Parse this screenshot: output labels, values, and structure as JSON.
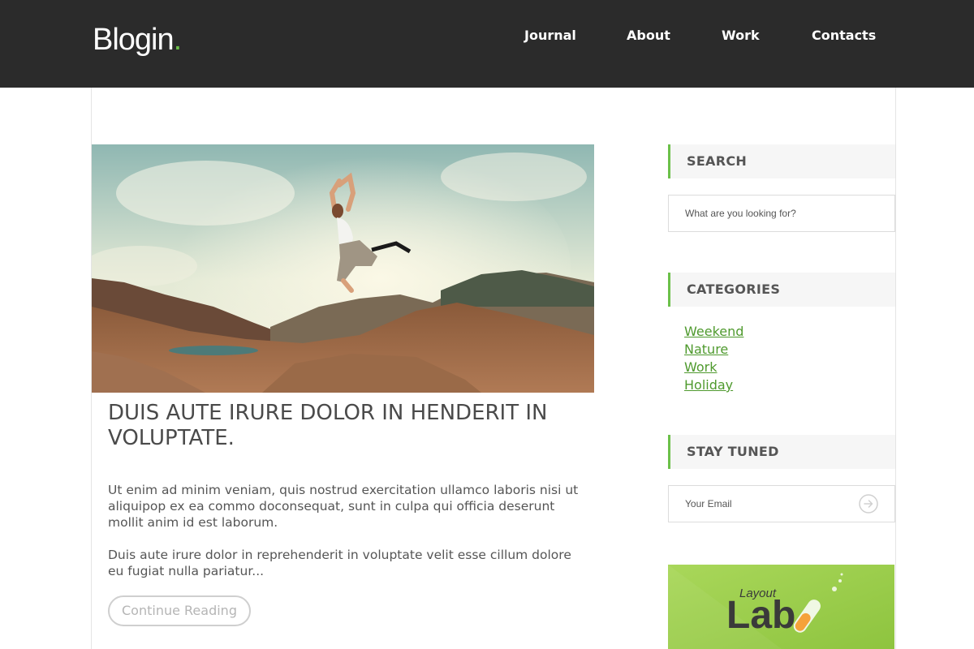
{
  "header": {
    "logo_text": "Blogin",
    "logo_dot": ".",
    "nav": [
      "Journal",
      "About",
      "Work",
      "Contacts"
    ]
  },
  "post": {
    "title": "Duis aute irure dolor in henderit in voluptate.",
    "paragraphs": [
      "Ut enim ad minim veniam, quis nostrud exercitation ullamco laboris nisi ut aliquipop ex ea commo doconsequat, sunt in culpa qui officia deserunt mollit anim id est laborum.",
      "Duis aute irure dolor in reprehenderit in voluptate velit esse cillum dolore eu fugiat nulla pariatur..."
    ],
    "continue_label": "Continue Reading"
  },
  "sidebar": {
    "search": {
      "title": "SEARCH",
      "placeholder": "What are you looking for?"
    },
    "categories": {
      "title": "CATEGORIES",
      "items": [
        "Weekend",
        "Nature",
        "Work",
        "Holiday"
      ]
    },
    "stay_tuned": {
      "title": "STAY TUNED",
      "placeholder": "Your Email"
    },
    "banner": {
      "small_text": "Layout",
      "big_text": "Lab"
    }
  },
  "colors": {
    "accent": "#6cc04a",
    "header_bg": "#2b2b2b",
    "link": "#4f9a2e"
  }
}
